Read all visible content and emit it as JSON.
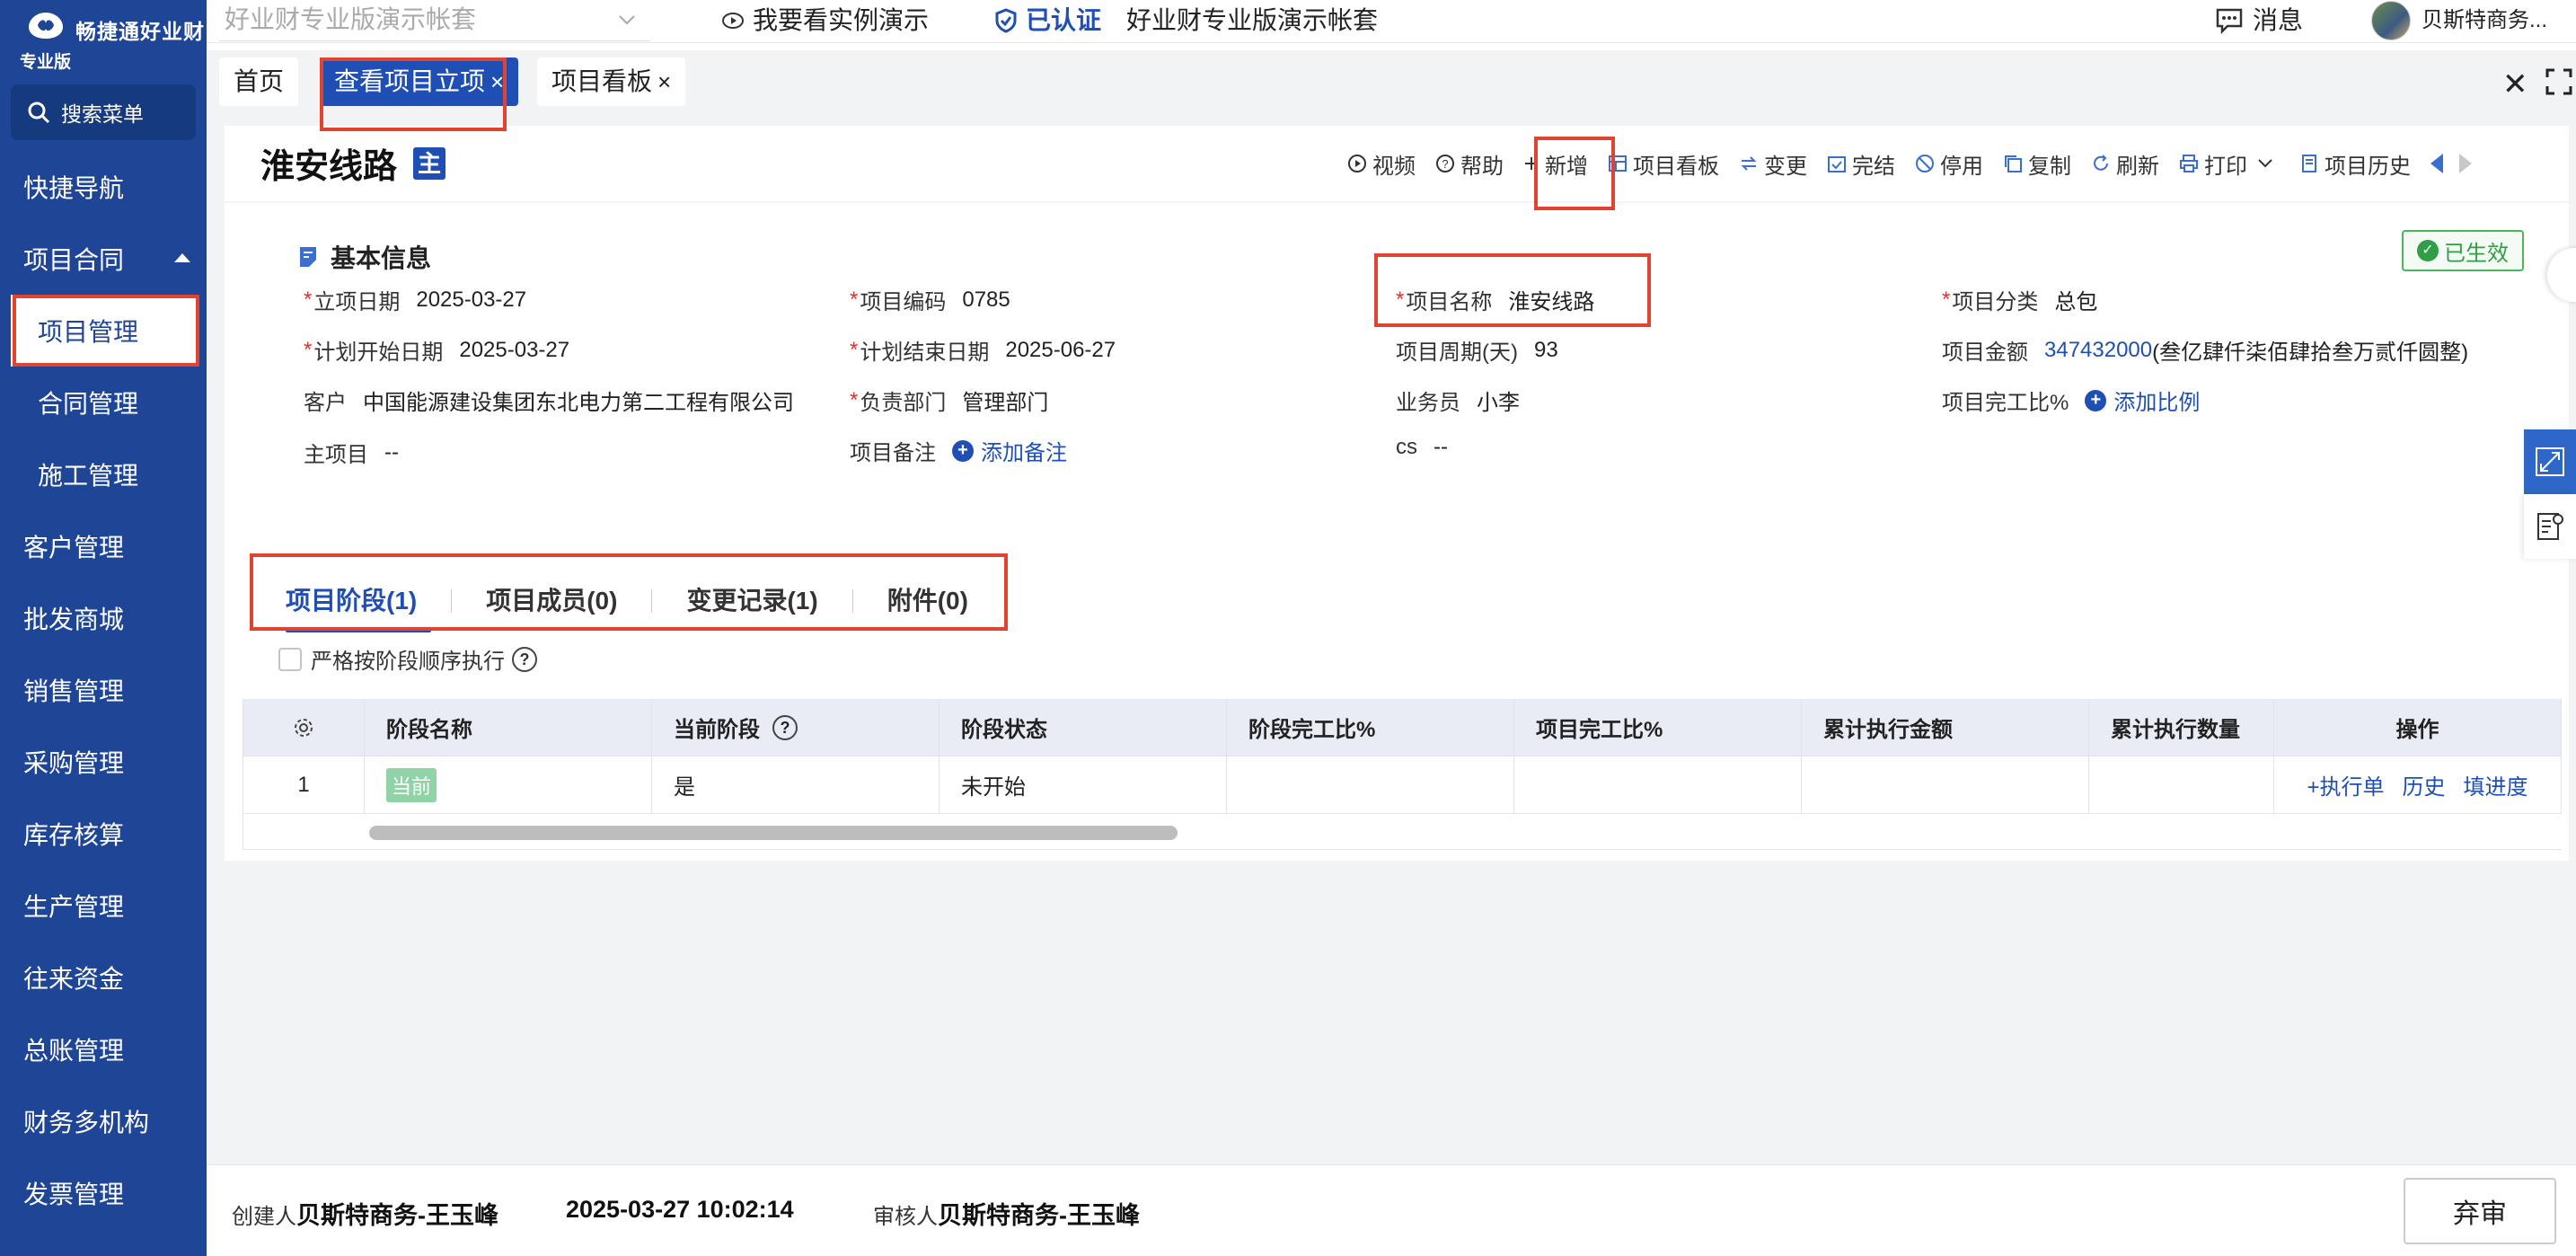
{
  "app": {
    "logo_name": "畅捷通好业财",
    "logo_sub": "专业版",
    "search_label": "搜索菜单"
  },
  "sidebar": {
    "items": [
      {
        "label": "快捷导航"
      },
      {
        "label": "项目合同"
      },
      {
        "label": "项目管理"
      },
      {
        "label": "合同管理"
      },
      {
        "label": "施工管理"
      },
      {
        "label": "客户管理"
      },
      {
        "label": "批发商城"
      },
      {
        "label": "销售管理"
      },
      {
        "label": "采购管理"
      },
      {
        "label": "库存核算"
      },
      {
        "label": "生产管理"
      },
      {
        "label": "往来资金"
      },
      {
        "label": "总账管理"
      },
      {
        "label": "财务多机构"
      },
      {
        "label": "发票管理"
      }
    ]
  },
  "topbar": {
    "account_placeholder": "好业财专业版演示帐套",
    "demo_link": "我要看实例演示",
    "certified": "已认证",
    "account_name": "好业财专业版演示帐套",
    "messages": "消息",
    "user_name": "贝斯特商务..."
  },
  "tabs": [
    {
      "label": "首页"
    },
    {
      "label": "查看项目立项"
    },
    {
      "label": "项目看板"
    }
  ],
  "page": {
    "title": "淮安线路",
    "main_badge": "主",
    "status": "已生效"
  },
  "toolbar": {
    "video": "视频",
    "help": "帮助",
    "add": "新增",
    "board": "项目看板",
    "change": "变更",
    "complete": "完结",
    "disable": "停用",
    "copy": "复制",
    "refresh": "刷新",
    "print": "打印",
    "history": "项目历史"
  },
  "basic_info": {
    "section_title": "基本信息",
    "fields": {
      "setup_date": {
        "label": "立项日期",
        "value": "2025-03-27"
      },
      "code": {
        "label": "项目编码",
        "value": "0785"
      },
      "name": {
        "label": "项目名称",
        "value": "淮安线路"
      },
      "category": {
        "label": "项目分类",
        "value": "总包"
      },
      "plan_start": {
        "label": "计划开始日期",
        "value": "2025-03-27"
      },
      "plan_end": {
        "label": "计划结束日期",
        "value": "2025-06-27"
      },
      "period": {
        "label": "项目周期(天)",
        "value": "93"
      },
      "amount": {
        "label": "项目金额",
        "value": "347432000",
        "caps": "(叁亿肆仟柒佰肆拾叁万贰仟圆整)"
      },
      "customer": {
        "label": "客户",
        "value": "中国能源建设集团东北电力第二工程有限公司"
      },
      "dept": {
        "label": "负责部门",
        "value": "管理部门"
      },
      "salesman": {
        "label": "业务员",
        "value": "小李"
      },
      "complete_ratio": {
        "label": "项目完工比%",
        "action": "添加比例"
      },
      "main_project": {
        "label": "主项目",
        "value": "--"
      },
      "remark": {
        "label": "项目备注",
        "action": "添加备注"
      },
      "cs": {
        "label": "cs",
        "value": "--"
      }
    }
  },
  "subtabs": [
    {
      "label": "项目阶段(1)"
    },
    {
      "label": "项目成员(0)"
    },
    {
      "label": "变更记录(1)"
    },
    {
      "label": "附件(0)"
    }
  ],
  "strict_order_label": "严格按阶段顺序执行",
  "table": {
    "columns": [
      "阶段名称",
      "当前阶段",
      "阶段状态",
      "阶段完工比%",
      "项目完工比%",
      "累计执行金额",
      "累计执行数量",
      "操作"
    ],
    "rows": [
      {
        "index": "1",
        "stage_name": "当前",
        "is_current": "是",
        "status": "未开始",
        "stage_ratio": "",
        "project_ratio": "",
        "amount": "",
        "qty": ""
      }
    ],
    "ops": [
      "+执行单",
      "历史",
      "填进度"
    ]
  },
  "footer": {
    "creator_label": "创建人",
    "creator": "贝斯特商务-王玉峰",
    "created_at": "2025-03-27 10:02:14",
    "reviewer_label": "审核人",
    "reviewer": "贝斯特商务-王玉峰",
    "abandon": "弃审"
  },
  "colors": {
    "sidebar": "#1f4597",
    "accent": "#1f4fb5",
    "status_green": "#2f9e44",
    "required": "#e03131",
    "highlight": "#e0432f"
  }
}
